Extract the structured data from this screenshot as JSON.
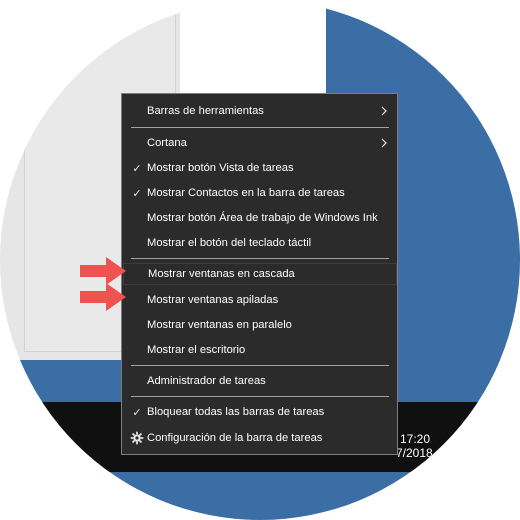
{
  "menu": {
    "items": [
      {
        "label": "Barras de herramientas",
        "checked": false,
        "submenu": true
      },
      {
        "label": "Cortana",
        "checked": false,
        "submenu": true
      },
      {
        "label": "Mostrar botón Vista de tareas",
        "checked": true
      },
      {
        "label": "Mostrar Contactos en la barra de tareas",
        "checked": true
      },
      {
        "label": "Mostrar botón Área de trabajo de Windows Ink",
        "checked": false
      },
      {
        "label": "Mostrar el botón del teclado táctil",
        "checked": false
      },
      {
        "label": "Mostrar ventanas en cascada",
        "checked": false
      },
      {
        "label": "Mostrar ventanas apiladas",
        "checked": false
      },
      {
        "label": "Mostrar ventanas en paralelo",
        "checked": false
      },
      {
        "label": "Mostrar el escritorio",
        "checked": false
      },
      {
        "label": "Administrador de tareas",
        "checked": false
      },
      {
        "label": "Bloquear todas las barras de tareas",
        "checked": true
      },
      {
        "label": "Configuración de la barra de tareas",
        "checked": false,
        "icon": "gear-icon"
      }
    ]
  },
  "taskbar": {
    "clock_time": "17:20",
    "clock_date": "7/2018"
  },
  "icons": {
    "check": "check-icon",
    "submenu": "chevron-right-icon",
    "settings": "gear-icon",
    "highlight": "red-arrow-icon"
  },
  "colors": {
    "menu_bg": "#2b2b2b",
    "menu_border": "#7d7d7d",
    "desktop": "#3a6ea5",
    "taskbar": "#101010",
    "arrow": "#ef5350"
  }
}
